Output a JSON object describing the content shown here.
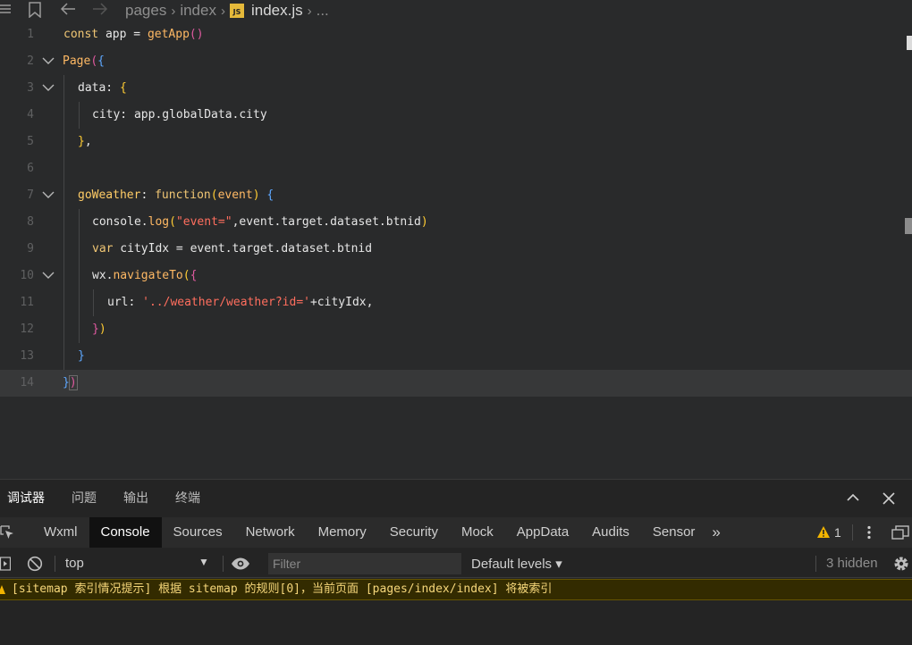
{
  "breadcrumb": {
    "items": [
      "pages",
      "index"
    ],
    "file": "index.js",
    "more": "...",
    "file_badge": "JS"
  },
  "editor": {
    "line_numbers": [
      "1",
      "2",
      "3",
      "4",
      "5",
      "6",
      "7",
      "8",
      "9",
      "10",
      "11",
      "12",
      "13",
      "14"
    ],
    "current_line": 14
  },
  "devtools": {
    "top_tabs": [
      "调试器",
      "问题",
      "输出",
      "终端"
    ],
    "active_top_tab": "调试器",
    "panel_tabs": [
      "Wxml",
      "Console",
      "Sources",
      "Network",
      "Memory",
      "Security",
      "Mock",
      "AppData",
      "Audits",
      "Sensor"
    ],
    "active_panel_tab": "Console",
    "more_tabs": "»",
    "warning_count": "1",
    "context": "top",
    "filter_placeholder": "Filter",
    "levels": "Default levels ▾",
    "hidden": "3 hidden",
    "message": "[sitemap 索引情况提示] 根据 sitemap 的规则[0]，当前页面 [pages/index/index] 将被索引"
  },
  "colors": {
    "editor_bg": "#292a2b",
    "current_line_bg": "#373839",
    "console_active_tab_bg": "#111111",
    "warning_text": "#f5d67a",
    "warning_bg": "#332b00"
  }
}
